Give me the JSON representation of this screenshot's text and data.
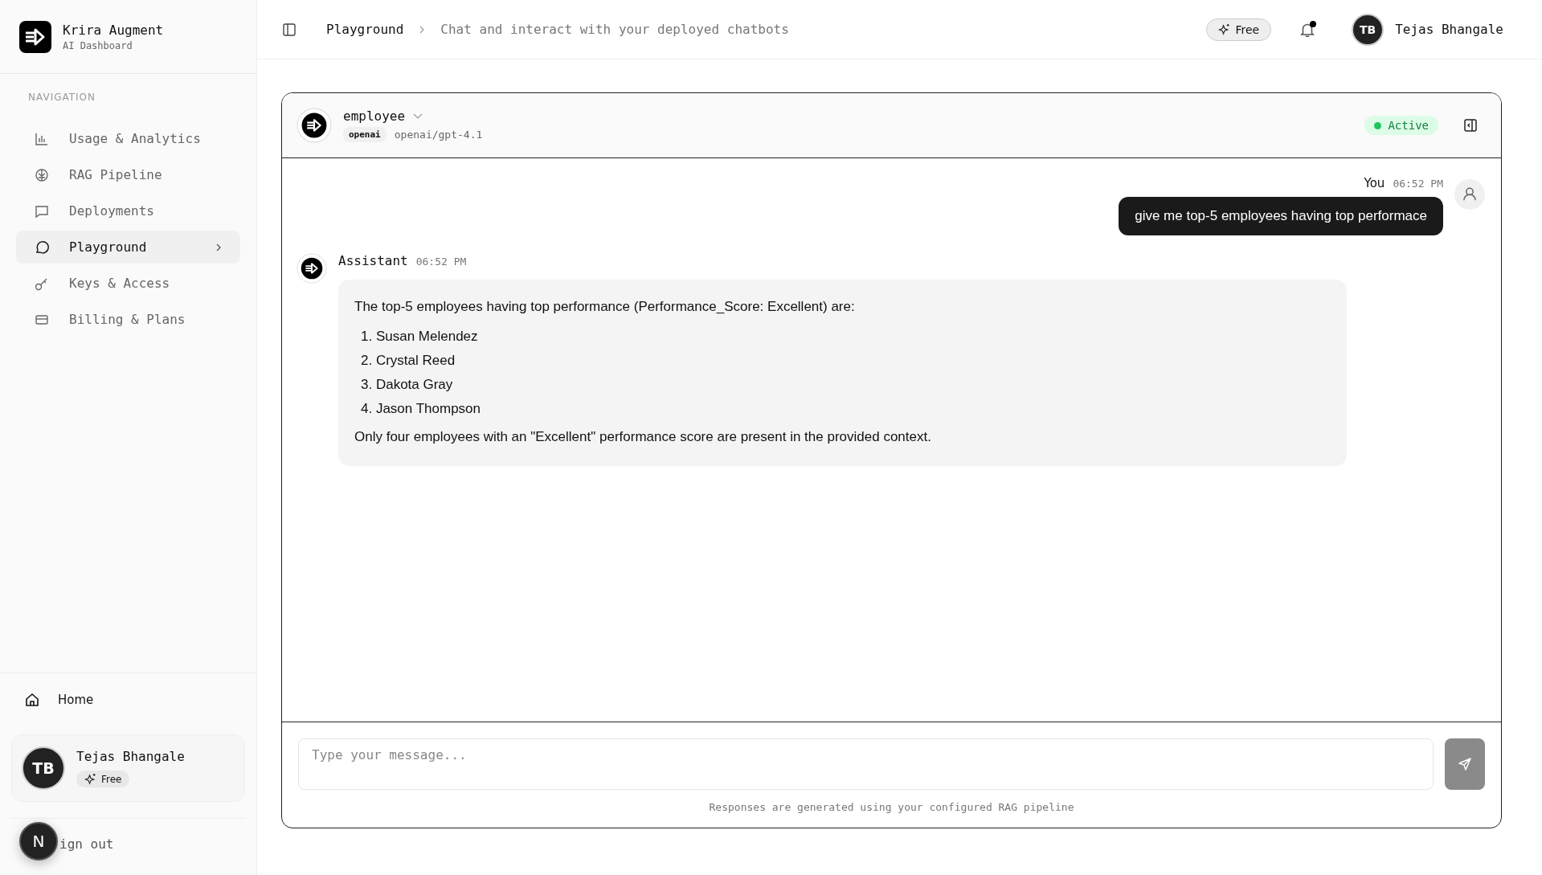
{
  "brand": {
    "name": "Krira Augment",
    "subtitle": "AI Dashboard"
  },
  "sidebar": {
    "section_label": "NAVIGATION",
    "items": [
      {
        "label": "Usage & Analytics",
        "selected": false
      },
      {
        "label": "RAG Pipeline",
        "selected": false
      },
      {
        "label": "Deployments",
        "selected": false
      },
      {
        "label": "Playground",
        "selected": true
      },
      {
        "label": "Keys & Access",
        "selected": false
      },
      {
        "label": "Billing & Plans",
        "selected": false
      }
    ],
    "home": "Home",
    "user": {
      "initials": "TB",
      "name": "Tejas Bhangale",
      "plan": "Free"
    },
    "sign_out": "ign out",
    "dev_badge": "N"
  },
  "header": {
    "breadcrumb": "Playground",
    "subtitle": "Chat and interact with your deployed chatbots",
    "plan": "Free",
    "notification_unread": true,
    "user": {
      "initials": "TB",
      "name": "Tejas Bhangale"
    }
  },
  "chat": {
    "bot_name": "employee",
    "provider": "openai",
    "model": "openai/gpt-4.1",
    "status": "Active",
    "messages": [
      {
        "kind": "user",
        "sender": "You",
        "time": "06:52 PM",
        "text": "give me top-5 employees having top performace"
      },
      {
        "kind": "assistant",
        "sender": "Assistant",
        "time": "06:52 PM",
        "intro": "The top-5 employees having top performance (Performance_Score: Excellent) are:",
        "list": [
          {
            "number": "1.",
            "text": "Susan Melendez"
          },
          {
            "number": "2.",
            "text": "Crystal Reed"
          },
          {
            "number": "3.",
            "text": "Dakota Gray"
          },
          {
            "number": "4.",
            "text": "Jason Thompson"
          }
        ],
        "outro": "Only four employees with an \"Excellent\" performance score are present in the provided context."
      }
    ],
    "input": {
      "placeholder": "Type your message..."
    },
    "footnote": "Responses are generated using your configured RAG pipeline"
  }
}
